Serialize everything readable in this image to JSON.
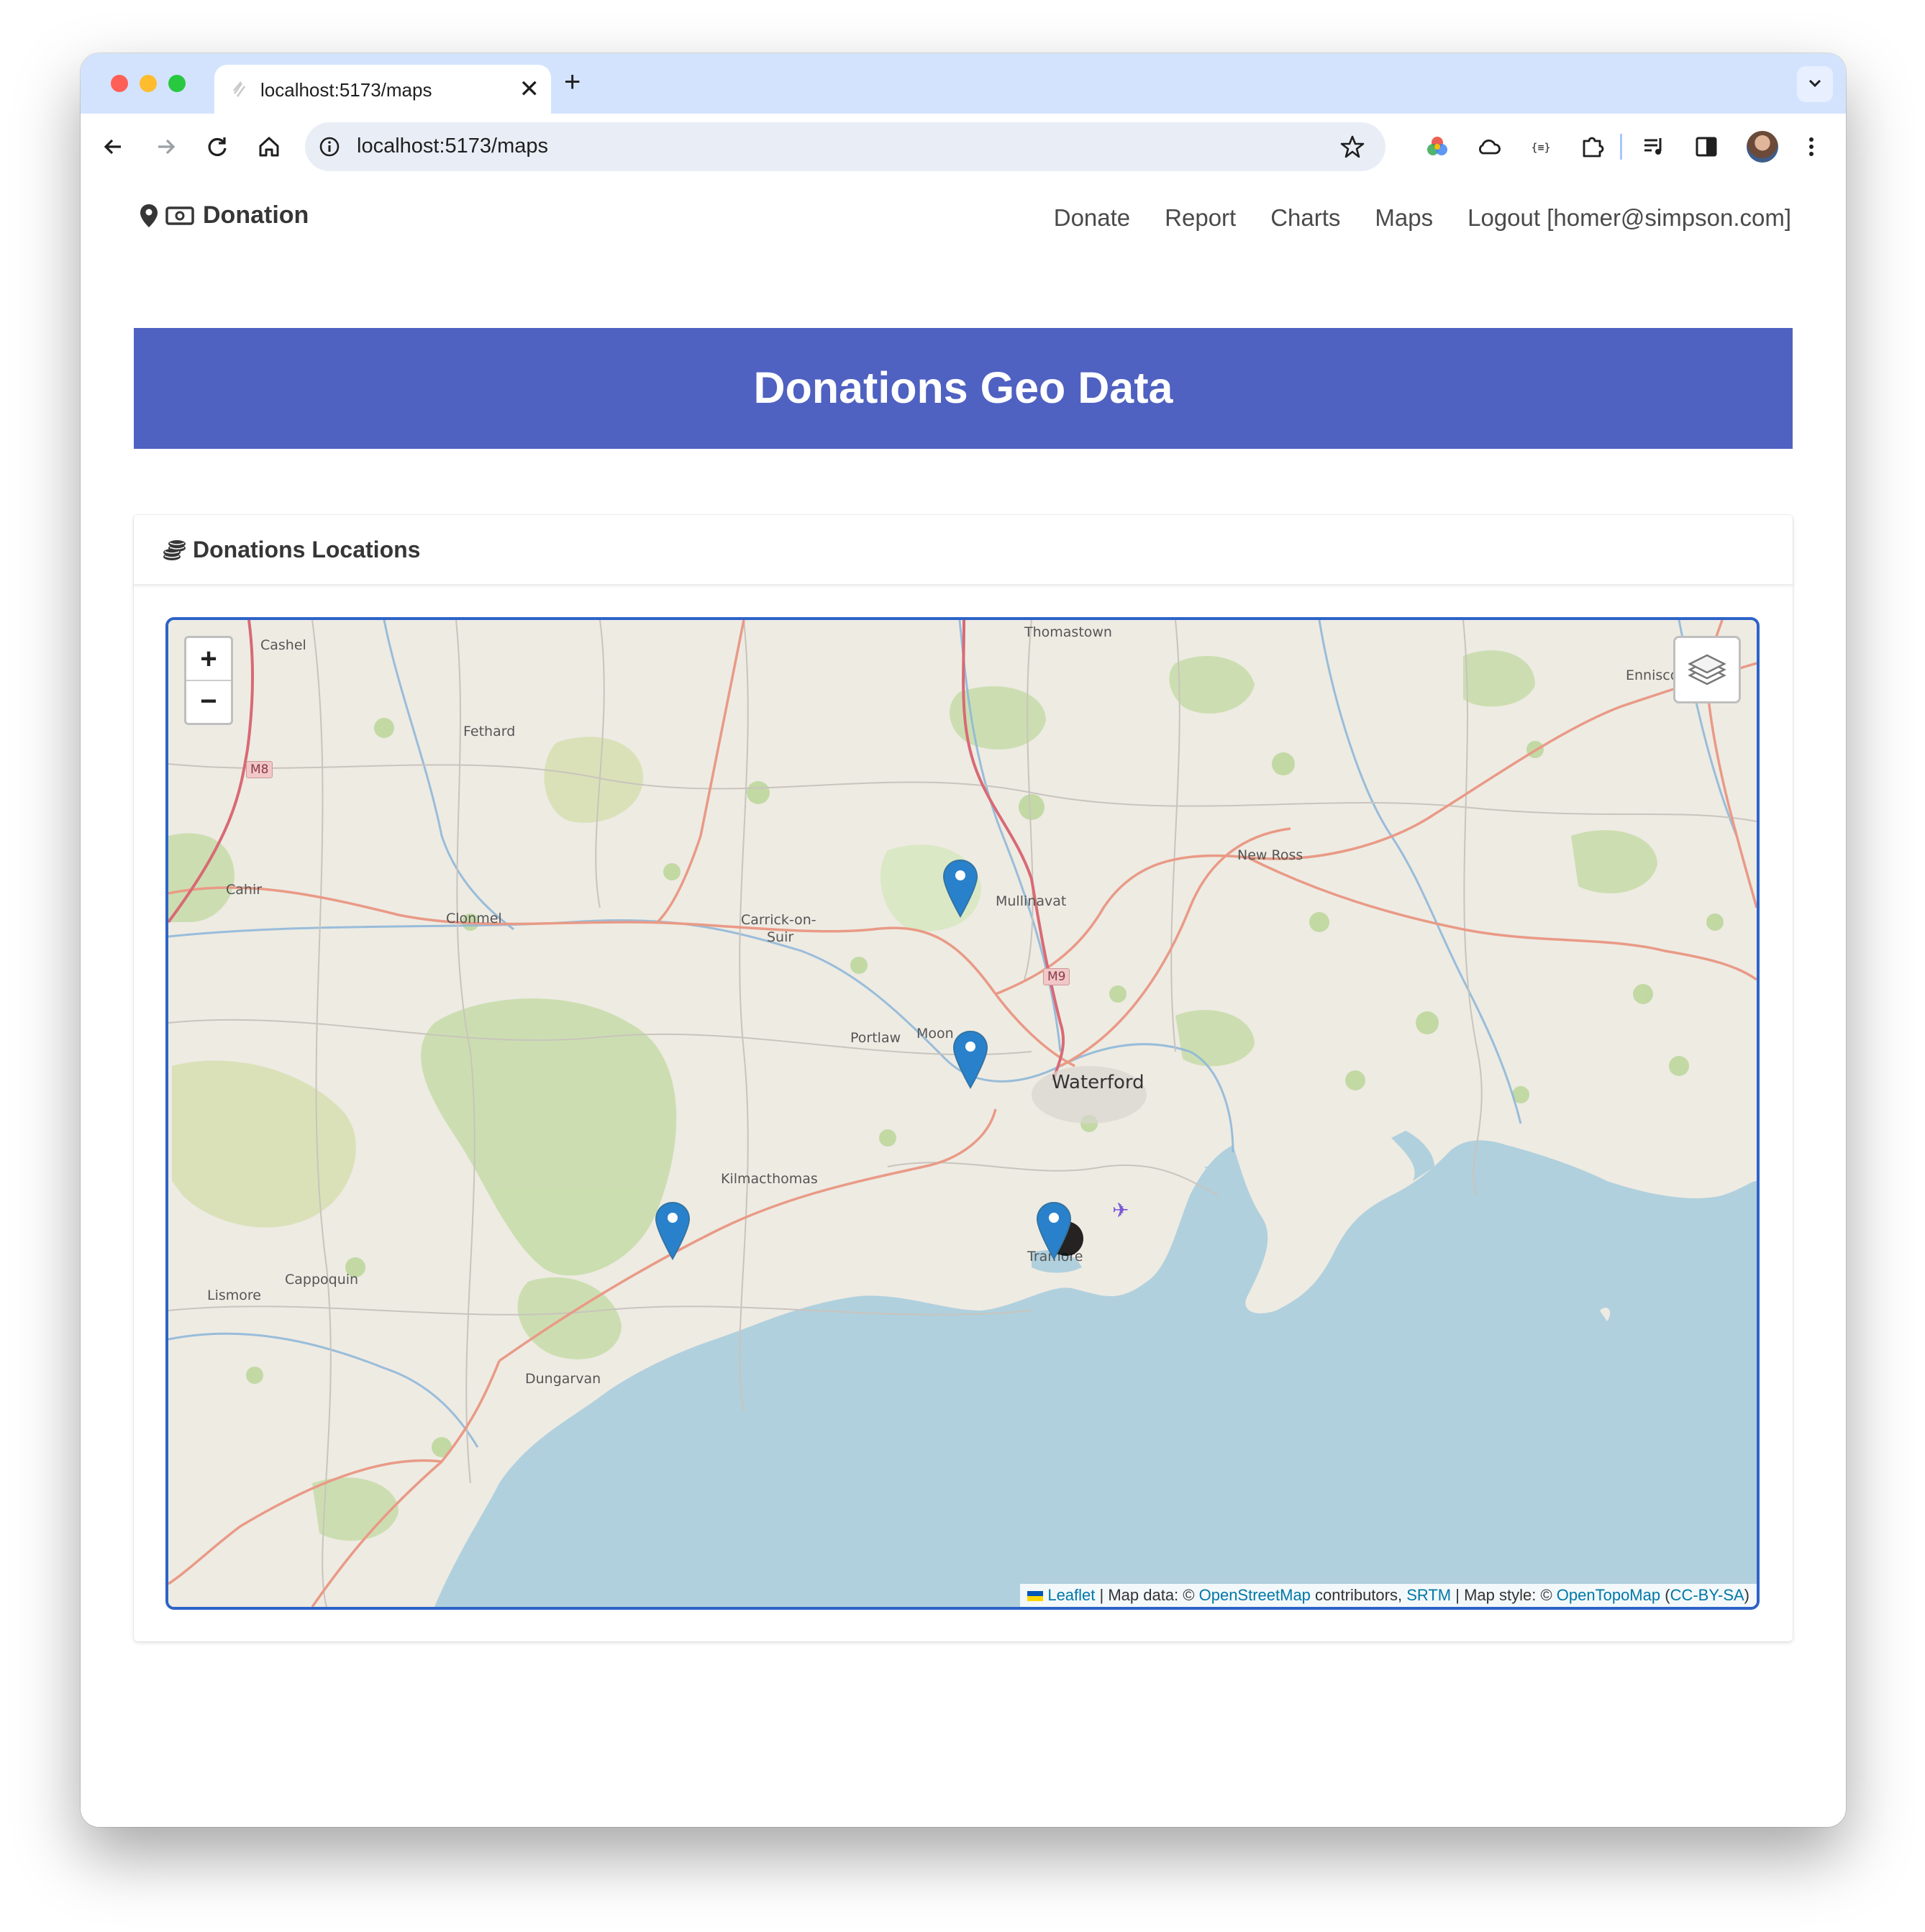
{
  "browser": {
    "tab_title": "localhost:5173/maps",
    "tab_close": "✕",
    "new_tab": "+",
    "url": "localhost:5173/maps"
  },
  "navbar": {
    "brand": "Donation",
    "links": [
      "Donate",
      "Report",
      "Charts",
      "Maps",
      "Logout [homer@simpson.com]"
    ]
  },
  "hero": {
    "title": "Donations Geo Data"
  },
  "card": {
    "title": "Donations Locations"
  },
  "map": {
    "zoom_in": "+",
    "zoom_out": "−",
    "places": {
      "cashel": "Cashel",
      "thomastown": "Thomastown",
      "fethard": "Fethard",
      "enniscorthy": "Ennisco",
      "new_ross": "New Ross",
      "cahir": "Cahir",
      "clonmel": "Clonmel",
      "carrick": "Carrick-on-",
      "suir": "Suir",
      "mullinavat": "Mullinavat",
      "portlaw": "Portlaw",
      "mooncoin": "Moon",
      "waterford": "Waterford",
      "kilmacthomas": "Kilmacthomas",
      "cappoquin": "Cappoquin",
      "lismore": "Lismore",
      "tramore": "Tramore",
      "dungarvan": "Dungarvan"
    },
    "roads": {
      "m8": "M8",
      "m9": "M9"
    },
    "markers_count": 4,
    "attribution": {
      "leaflet": "Leaflet",
      "sep1": " | Map data: © ",
      "osm": "OpenStreetMap",
      "contributors": " contributors, ",
      "srtm": "SRTM",
      "sep2": " | Map style: © ",
      "otm": "OpenTopoMap",
      "paren_open": " (",
      "license": "CC-BY-SA",
      "paren_close": ")"
    }
  },
  "colors": {
    "hero_bg": "#4f61c1",
    "map_border": "#2d63c8",
    "sea": "#b0d0dd",
    "marker": "#2a81cb"
  }
}
